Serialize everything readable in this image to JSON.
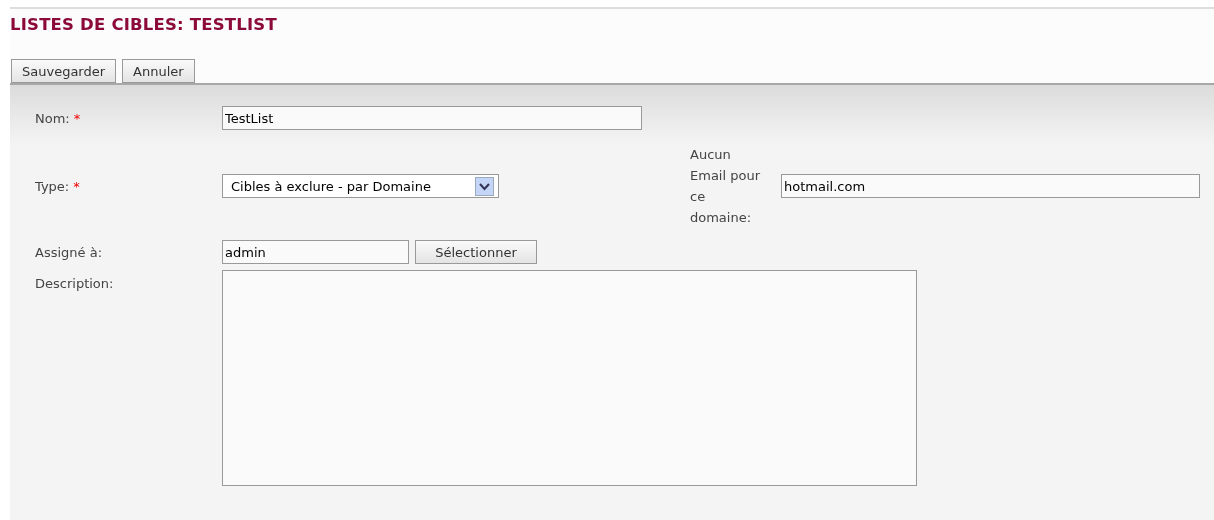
{
  "title": "LISTES DE CIBLES: TESTLIST",
  "buttons": [
    "Sauvegarder",
    "Annuler"
  ],
  "fields": {
    "name": {
      "label": "Nom:",
      "required_mark": "*",
      "value": "TestList"
    },
    "type": {
      "label": "Type:",
      "required_mark": "*",
      "value": "Cibles à exclure - par Domaine"
    },
    "domain": {
      "label": "Aucun Email pour ce domaine:",
      "value": "hotmail.com"
    },
    "assigned": {
      "label": "Assigné à:",
      "value": "admin",
      "button": "Sélectionner"
    },
    "description": {
      "label": "Description:"
    }
  }
}
